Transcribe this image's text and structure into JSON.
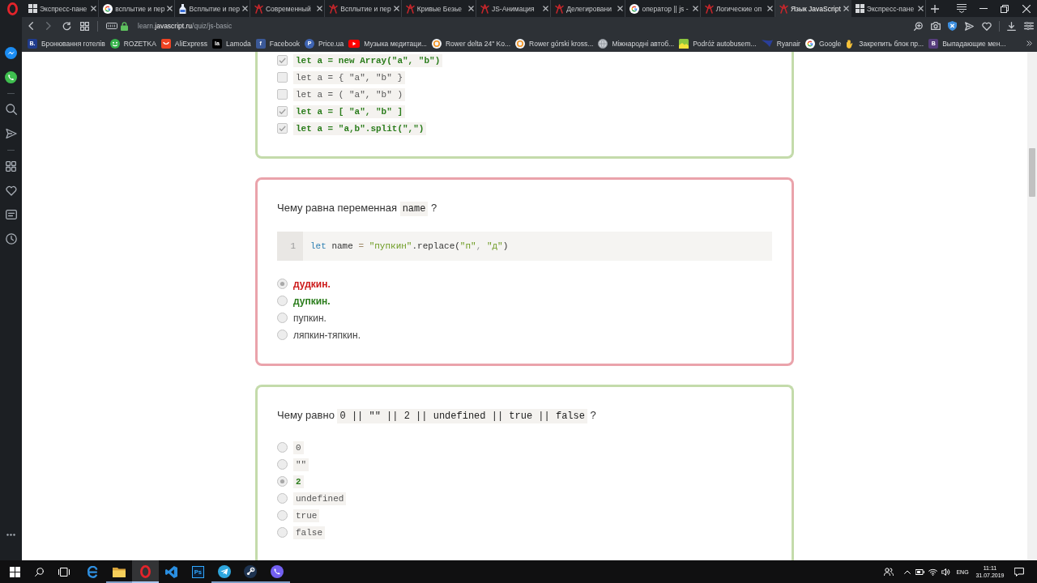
{
  "browser": {
    "tabs": [
      {
        "title": "Экспресс-пане",
        "kind": "speed-dial",
        "selected": false
      },
      {
        "title": "всплытие и пер",
        "kind": "google",
        "selected": false
      },
      {
        "title": "Всплытие и пер",
        "kind": "bottle",
        "selected": false
      },
      {
        "title": "Современный",
        "kind": "site",
        "selected": false
      },
      {
        "title": "Всплытие и пер",
        "kind": "site",
        "selected": false
      },
      {
        "title": "Кривые Безье",
        "kind": "site",
        "selected": false
      },
      {
        "title": "JS-Анимация",
        "kind": "site",
        "selected": false
      },
      {
        "title": "Делегировани",
        "kind": "site",
        "selected": false
      },
      {
        "title": "оператор || js -",
        "kind": "google",
        "selected": false
      },
      {
        "title": "Логические оп",
        "kind": "site",
        "selected": false
      },
      {
        "title": "Язык JavaScript",
        "kind": "site",
        "selected": true
      },
      {
        "title": "Экспресс-пане",
        "kind": "speed-dial",
        "selected": false
      }
    ],
    "address": [
      {
        "text": "learn.",
        "kind": "subdomain"
      },
      {
        "text": "javascript.ru",
        "kind": "domain"
      },
      {
        "text": "/quiz/js-basic",
        "kind": "path"
      }
    ],
    "bookmarks": [
      {
        "label": "Бронювання готелів",
        "kind": "tile",
        "letter": "B.",
        "color": "#1f3b8c"
      },
      {
        "label": "ROZETKA",
        "kind": "smiley"
      },
      {
        "label": "AliExpress",
        "kind": "bag"
      },
      {
        "label": "Lamoda",
        "kind": "tile",
        "letter": "la",
        "color": "#000000"
      },
      {
        "label": "Facebook",
        "kind": "tile",
        "letter": "f",
        "color": "#3b5998"
      },
      {
        "label": "Price.ua",
        "kind": "disc",
        "letter": "P",
        "color": "#3e64b2"
      },
      {
        "label": "Музыка медитаци...",
        "kind": "play"
      },
      {
        "label": "Rower delta 24\" Ko...",
        "kind": "ring"
      },
      {
        "label": "Rower górski kross...",
        "kind": "ring"
      },
      {
        "label": "Міжнародні автоб...",
        "kind": "globe"
      },
      {
        "label": "Podróż autobusem...",
        "kind": "picture"
      },
      {
        "label": "Ryanair",
        "kind": "wing"
      },
      {
        "label": "Google",
        "kind": "google"
      },
      {
        "label": "Закрепить блок пр...",
        "kind": "hand"
      },
      {
        "label": "Выпадающие мен...",
        "kind": "tile",
        "letter": "B",
        "color": "#563d7c"
      }
    ]
  },
  "quiz": {
    "questions": [
      {
        "correct": true,
        "kind": "checkbox",
        "options": [
          {
            "text": "let a = new Array(\"a\", \"b\")",
            "kind": "code",
            "checked": true,
            "correct": true
          },
          {
            "text": "let a = { \"a\", \"b\" }",
            "kind": "code",
            "checked": false,
            "correct": false
          },
          {
            "text": "let a = ( \"a\", \"b\" )",
            "kind": "code",
            "checked": false,
            "correct": false
          },
          {
            "text": "let a = [ \"a\", \"b\" ]",
            "kind": "code",
            "checked": true,
            "correct": true
          },
          {
            "text": "let a = \"a,b\".split(\",\")",
            "kind": "code",
            "checked": true,
            "correct": true
          }
        ]
      },
      {
        "correct": false,
        "kind": "radio",
        "question": [
          {
            "kind": "text",
            "text": "Чему равна переменная "
          },
          {
            "kind": "code",
            "text": "name"
          },
          {
            "kind": "text",
            "text": " ?"
          }
        ],
        "code": [
          {
            "number": "1",
            "tokens": [
              {
                "kind": "keyword",
                "text": "let"
              },
              {
                "kind": "plain",
                "text": " name "
              },
              {
                "kind": "operator",
                "text": "= "
              },
              {
                "kind": "string",
                "text": "\"пупкин\""
              },
              {
                "kind": "plain",
                "text": ".replace("
              },
              {
                "kind": "string",
                "text": "\"п\""
              },
              {
                "kind": "punctuation",
                "text": ", "
              },
              {
                "kind": "string",
                "text": "\"д\""
              },
              {
                "kind": "plain",
                "text": ")"
              }
            ]
          }
        ],
        "options": [
          {
            "text": "дудкин.",
            "kind": "text",
            "selected": true,
            "correct": false
          },
          {
            "text": "дупкин.",
            "kind": "text",
            "selected": false,
            "correct": true
          },
          {
            "text": "пупкин.",
            "kind": "text",
            "selected": false,
            "correct": false
          },
          {
            "text": "ляпкин-тяпкин.",
            "kind": "text",
            "selected": false,
            "correct": false
          }
        ]
      },
      {
        "correct": true,
        "kind": "radio",
        "question": [
          {
            "kind": "text",
            "text": "Чему равно "
          },
          {
            "kind": "code",
            "text": "0 || \"\" || 2 || undefined || true || false"
          },
          {
            "kind": "text",
            "text": " ?"
          }
        ],
        "options": [
          {
            "text": "0",
            "kind": "code",
            "selected": false,
            "correct": false
          },
          {
            "text": "\"\"",
            "kind": "code",
            "selected": false,
            "correct": false
          },
          {
            "text": "2",
            "kind": "code",
            "selected": true,
            "correct": true
          },
          {
            "text": "undefined",
            "kind": "code",
            "selected": false,
            "correct": false
          },
          {
            "text": "true",
            "kind": "code",
            "selected": false,
            "correct": false
          },
          {
            "text": "false",
            "kind": "code",
            "selected": false,
            "correct": false
          }
        ]
      }
    ]
  },
  "taskbar": {
    "apps": [
      {
        "kind": "e-logo",
        "running": false,
        "selected": false
      },
      {
        "kind": "folder",
        "running": true,
        "selected": false
      },
      {
        "kind": "o-logo",
        "running": true,
        "selected": true
      },
      {
        "kind": "ribbon",
        "running": false,
        "selected": false
      },
      {
        "kind": "letter",
        "letter": "Ps",
        "running": false,
        "selected": false
      },
      {
        "kind": "plane",
        "running": true,
        "selected": false
      },
      {
        "kind": "piston",
        "running": true,
        "selected": false
      },
      {
        "kind": "phone",
        "running": true,
        "selected": false
      }
    ],
    "language": "ENG",
    "time": "11:11",
    "date": "31.07.2019"
  }
}
